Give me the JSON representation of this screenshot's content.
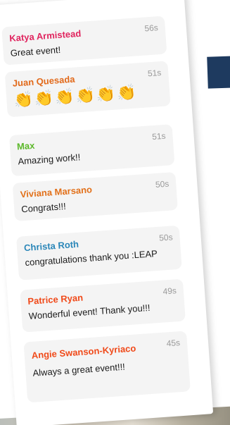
{
  "messages": [
    {
      "name": "Katya Armistead",
      "time": "56s",
      "text": "Great event!",
      "color": "#e0245e"
    },
    {
      "name": "Juan Quesada",
      "time": "51s",
      "text": "👏👏👏👏👏👏",
      "color": "#e26a1b"
    },
    {
      "name": "Max",
      "time": "51s",
      "text": "Amazing work!!",
      "color": "#5cb82a"
    },
    {
      "name": "Viviana Marsano",
      "time": "50s",
      "text": "Congrats!!!",
      "color": "#e2711b"
    },
    {
      "name": "Christa Roth",
      "time": "50s",
      "text": "congratulations thank you :LEAP",
      "color": "#2a86b8"
    },
    {
      "name": "Patrice Ryan",
      "time": "49s",
      "text": "Wonderful event! Thank you!!!",
      "color": "#f04a1a"
    },
    {
      "name": "Angie Swanson-Kyriaco",
      "time": "45s",
      "text": "Always a great event!!!",
      "color": "#f04a1a"
    }
  ]
}
